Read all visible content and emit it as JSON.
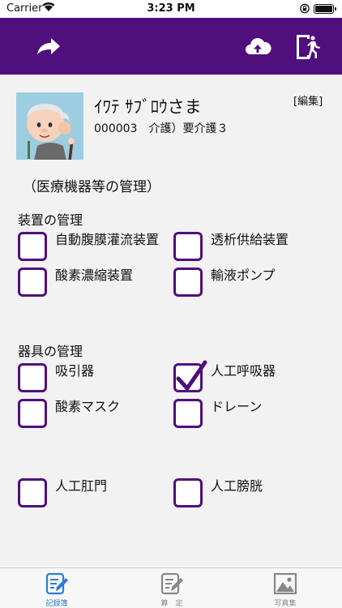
{
  "status_bar": {
    "carrier": "Carrier",
    "time": "3:23 PM"
  },
  "nav": {
    "accent_color": "#4f0f7d",
    "icons": [
      "forward-arrow-icon",
      "cloud-upload-icon",
      "exit-door-icon"
    ]
  },
  "profile": {
    "name": "ｲﾜﾃ ｻﾌﾞﾛｳさま",
    "info": "000003　介護）要介護３",
    "edit_label": "[編集]"
  },
  "section_title": "（医療機器等の管理）",
  "groups": [
    {
      "title": "装置の管理",
      "items": [
        {
          "label": "自動腹膜灌流装置",
          "checked": false
        },
        {
          "label": "透析供給装置",
          "checked": false
        },
        {
          "label": "酸素濃縮装置",
          "checked": false
        },
        {
          "label": "輸液ポンプ",
          "checked": false
        }
      ]
    },
    {
      "title": "器具の管理",
      "items": [
        {
          "label": "吸引器",
          "checked": false
        },
        {
          "label": "人工呼吸器",
          "checked": true
        },
        {
          "label": "酸素マスク",
          "checked": false
        },
        {
          "label": "ドレーン",
          "checked": false
        },
        {
          "label": "人工肛門",
          "checked": false
        },
        {
          "label": "人工膀胱",
          "checked": false
        }
      ]
    }
  ],
  "tabs": [
    {
      "label": "記録簿",
      "icon": "edit-note-icon",
      "active": true
    },
    {
      "label": "算　定",
      "icon": "calculate-note-icon",
      "active": false
    },
    {
      "label": "写真集",
      "icon": "photo-icon",
      "active": false
    }
  ]
}
